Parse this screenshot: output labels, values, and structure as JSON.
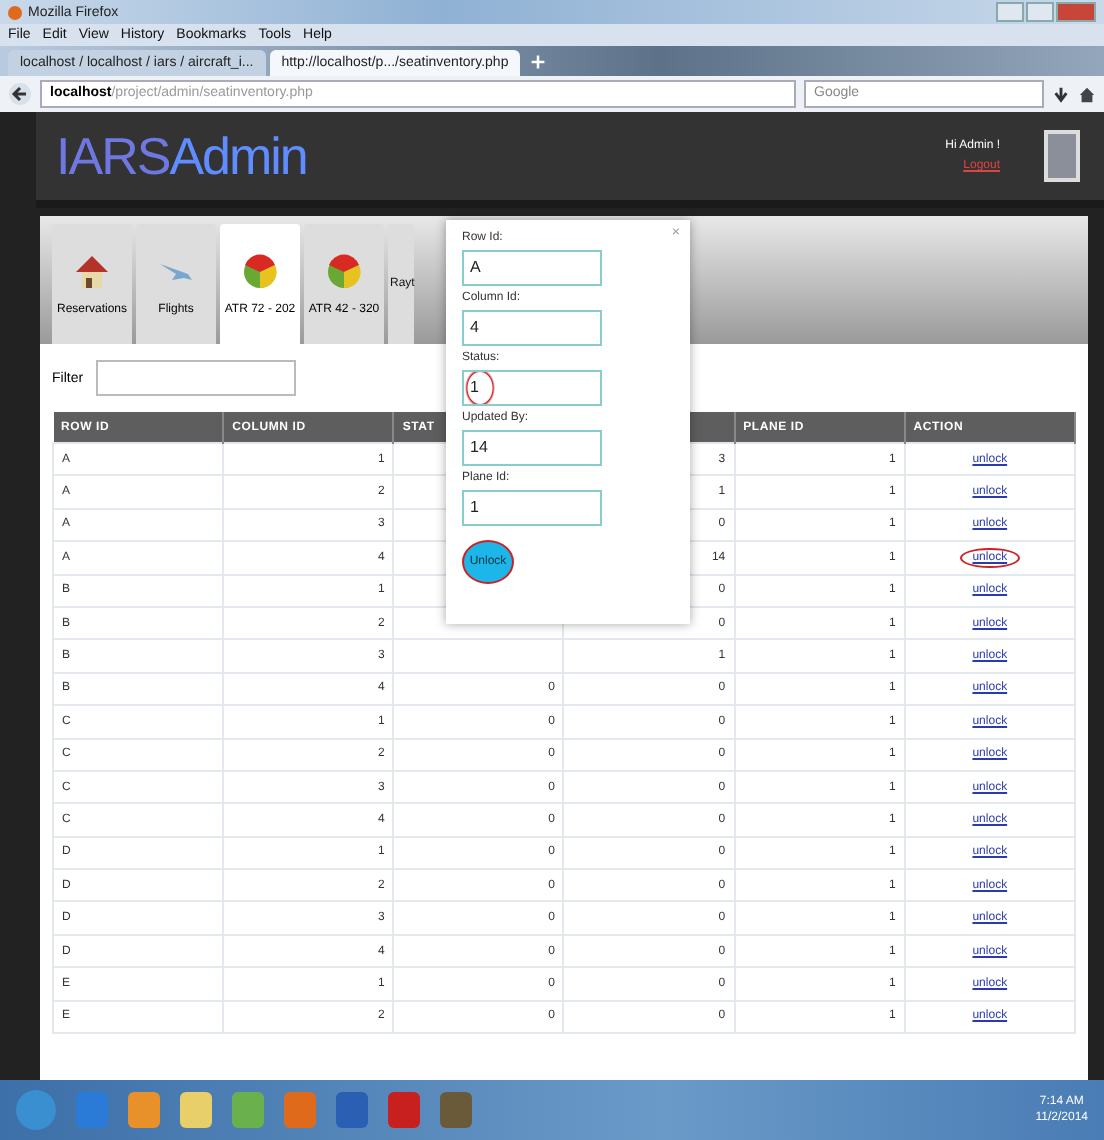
{
  "window": {
    "title": "Mozilla Firefox"
  },
  "menu": [
    "File",
    "Edit",
    "View",
    "History",
    "Bookmarks",
    "Tools",
    "Help"
  ],
  "browser_tabs": [
    {
      "label": "localhost / localhost / iars / aircraft_i...",
      "selected": false
    },
    {
      "label": "http://localhost/p.../seatinventory.php",
      "selected": true
    }
  ],
  "address_bar": {
    "host": "localhost",
    "path": "/project/admin/seatinventory.php"
  },
  "search": {
    "placeholder": "Google"
  },
  "header": {
    "logo_main": "IARS",
    "logo_sub": "Admin",
    "greeting": "Hi Admin !",
    "logout": "Logout"
  },
  "nav": [
    {
      "label": "Reservations",
      "kind": "house",
      "selected": false
    },
    {
      "label": "Flights",
      "kind": "plane",
      "selected": false
    },
    {
      "label": "ATR 72 - 202",
      "kind": "ball",
      "selected": true
    },
    {
      "label": "ATR 42 - 320",
      "kind": "ball",
      "selected": false
    },
    {
      "label": "Rayt",
      "kind": "text",
      "selected": false
    }
  ],
  "filter": {
    "label": "Filter"
  },
  "table": {
    "columns": [
      "ROW ID",
      "COLUMN ID",
      "STAT",
      "",
      "PLANE ID",
      "ACTION"
    ],
    "rows": [
      {
        "cells": [
          "A",
          "1",
          null,
          "3",
          "1",
          "unlock"
        ],
        "circled": false
      },
      {
        "cells": [
          "A",
          "2",
          null,
          "1",
          "1",
          "unlock"
        ],
        "circled": false
      },
      {
        "cells": [
          "A",
          "3",
          null,
          "0",
          "1",
          "unlock"
        ],
        "circled": false
      },
      {
        "cells": [
          "A",
          "4",
          null,
          "14",
          "1",
          "unlock"
        ],
        "circled": true
      },
      {
        "cells": [
          "B",
          "1",
          null,
          "0",
          "1",
          "unlock"
        ],
        "circled": false
      },
      {
        "cells": [
          "B",
          "2",
          null,
          "0",
          "1",
          "unlock"
        ],
        "circled": false
      },
      {
        "cells": [
          "B",
          "3",
          null,
          "1",
          "1",
          "unlock"
        ],
        "circled": false
      },
      {
        "cells": [
          "B",
          "4",
          "0",
          "0",
          "1",
          "unlock"
        ],
        "circled": false
      },
      {
        "cells": [
          "C",
          "1",
          "0",
          "0",
          "1",
          "unlock"
        ],
        "circled": false
      },
      {
        "cells": [
          "C",
          "2",
          "0",
          "0",
          "1",
          "unlock"
        ],
        "circled": false
      },
      {
        "cells": [
          "C",
          "3",
          "0",
          "0",
          "1",
          "unlock"
        ],
        "circled": false
      },
      {
        "cells": [
          "C",
          "4",
          "0",
          "0",
          "1",
          "unlock"
        ],
        "circled": false
      },
      {
        "cells": [
          "D",
          "1",
          "0",
          "0",
          "1",
          "unlock"
        ],
        "circled": false
      },
      {
        "cells": [
          "D",
          "2",
          "0",
          "0",
          "1",
          "unlock"
        ],
        "circled": false
      },
      {
        "cells": [
          "D",
          "3",
          "0",
          "0",
          "1",
          "unlock"
        ],
        "circled": false
      },
      {
        "cells": [
          "D",
          "4",
          "0",
          "0",
          "1",
          "unlock"
        ],
        "circled": false
      },
      {
        "cells": [
          "E",
          "1",
          "0",
          "0",
          "1",
          "unlock"
        ],
        "circled": false
      },
      {
        "cells": [
          "E",
          "2",
          "0",
          "0",
          "1",
          "unlock"
        ],
        "circled": false
      }
    ]
  },
  "dialog": {
    "close": "×",
    "fields": [
      {
        "label": "Row Id:",
        "value": "A",
        "circled": false
      },
      {
        "label": "Column Id:",
        "value": "4",
        "circled": false
      },
      {
        "label": "Status:",
        "value": "1",
        "circled": true
      },
      {
        "label": "Updated By:",
        "value": "14",
        "circled": false
      },
      {
        "label": "Plane Id:",
        "value": "1",
        "circled": false
      }
    ],
    "button": {
      "label": "Unlock",
      "circled": true
    }
  },
  "taskbar": {
    "time": "7:14 AM",
    "date": "11/2/2014"
  }
}
